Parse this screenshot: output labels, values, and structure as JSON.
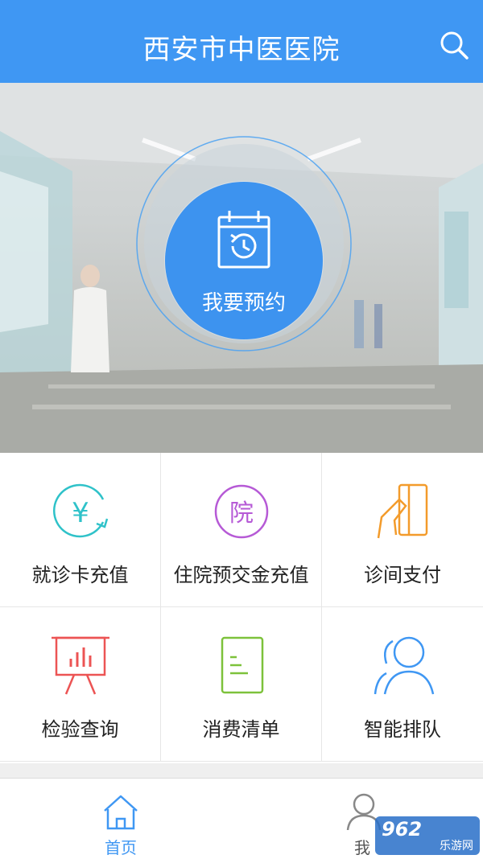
{
  "header": {
    "title": "西安市中医医院",
    "search_icon": "search-icon"
  },
  "hero": {
    "booking_label": "我要预约",
    "icon": "calendar-clock-icon"
  },
  "services": [
    {
      "label": "就诊卡充值",
      "icon": "yuan-recharge-icon",
      "color": "#2fc2c9"
    },
    {
      "label": "住院预交金充值",
      "icon": "hospital-circle-icon",
      "color": "#b65ad6"
    },
    {
      "label": "诊间支付",
      "icon": "card-payment-icon",
      "color": "#f39b2b"
    },
    {
      "label": "检验查询",
      "icon": "chart-board-icon",
      "color": "#ec5454"
    },
    {
      "label": "消费清单",
      "icon": "bill-list-icon",
      "color": "#7dc23b"
    },
    {
      "label": "智能排队",
      "icon": "people-queue-icon",
      "color": "#3f97f3"
    }
  ],
  "tabbar": {
    "home_label": "首页",
    "me_label": "我",
    "home_icon": "home-icon",
    "me_icon": "user-icon",
    "active_color": "#3f97f3"
  },
  "watermark": {
    "big": "962",
    "small": "乐游网"
  }
}
